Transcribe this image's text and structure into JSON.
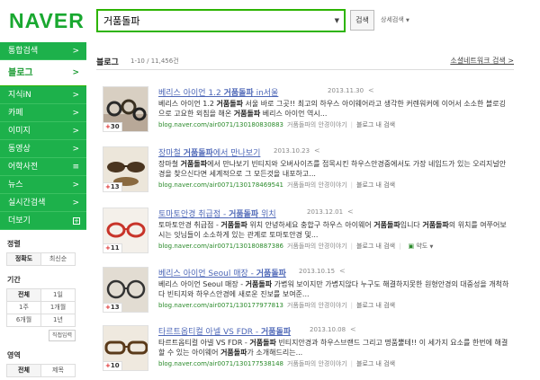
{
  "header": {
    "logo": "NAVER",
    "search_value": "거품돌파",
    "search_button": "검색",
    "advanced_search": "상세검색"
  },
  "sidebar": {
    "items": [
      {
        "label": "통합검색",
        "arrow": ">"
      },
      {
        "label": "블로그",
        "arrow": ">"
      },
      {
        "label": "지식iN",
        "arrow": ">"
      },
      {
        "label": "카페",
        "arrow": ">"
      },
      {
        "label": "이미지",
        "arrow": ">"
      },
      {
        "label": "동영상",
        "arrow": ">"
      },
      {
        "label": "어학사전",
        "arrow": "≡"
      },
      {
        "label": "뉴스",
        "arrow": ">"
      },
      {
        "label": "실시간검색",
        "arrow": ">"
      },
      {
        "label": "더보기",
        "arrow": "+"
      }
    ],
    "sort": {
      "title": "정렬",
      "options": [
        "정확도",
        "최신순"
      ]
    },
    "period": {
      "title": "기간",
      "options": [
        "전체",
        "1일",
        "1주",
        "1개월",
        "6개월",
        "1년"
      ],
      "direct": "직접입력"
    },
    "area": {
      "title": "영역",
      "options": [
        "전체",
        "제목"
      ]
    }
  },
  "results_header": {
    "title": "블로그",
    "count": "1-10 / 11,456건",
    "social_link": "소셜네트워크 검색 >"
  },
  "results": [
    {
      "title_pre": "베리스 아이언 1.2 ",
      "title_hl": "거품돌파",
      "title_post": " in서울",
      "date": "2013.11.30",
      "desc_parts": [
        "베리스 아이언 1.2 ",
        "거품돌파",
        " 서울 바로 그곳!! 최고의 하우스 아이웨어라고 생각한 커렌워커에 이어서 소소한 블로깅으로 고요한 외침을 해온 ",
        "거품돌파",
        " 베리스 아이언 역시..."
      ],
      "url": "blog.naver.com/air0071/130180830883",
      "blogname": "거품돌파의 안경이야기",
      "inblog": "블로그 내 검색",
      "badge": "30"
    },
    {
      "title_pre": "장마철 ",
      "title_hl": "거품돌파",
      "title_post": "에서 만나보기",
      "date": "2013.10.23",
      "desc_parts": [
        "장마철 ",
        "거품돌파",
        "에서 만나보기 빈티지와 오버사이즈를 접목시킨 하우스안경중에서도 가장 네임드가 있는 오리지널안경을 찾으신다면 세계적으로 그 모든것을 내포하고..."
      ],
      "url": "blog.naver.com/air0071/130178469541",
      "blogname": "거품돌파의 안경이야기",
      "inblog": "블로그 내 검색",
      "badge": "13"
    },
    {
      "title_pre": "토마토안경 취급점 - ",
      "title_hl": "거품돌파",
      "title_post": " 위치",
      "date": "2013.12.01",
      "desc_parts": [
        "토마토안경 취급점 - ",
        "거품돌파",
        " 위치 안녕하세요 충합구 하우스 아이웨어 ",
        "거품돌파",
        "입니다 ",
        "거품돌파",
        "의 위치를 여쭈어보시는 잇님들이 소소하게 있는 관계로 토마토안경 및..."
      ],
      "url": "blog.naver.com/air0071/130180887386",
      "blogname": "거품돌파의 안경이야기",
      "inblog": "블로그 내 검색",
      "map": "약도",
      "badge": "11"
    },
    {
      "title_pre": "베리스 아이언 Seoul 매장 - ",
      "title_hl": "거품돌파",
      "title_post": "",
      "date": "2013.10.15",
      "desc_parts": [
        "베리스 아이언 Seoul 매장 - ",
        "거품돌파",
        " 가볍워 보이지만 가볍지않다 누구도 해결하지못한 원형안경의 대중성을 개척하다 빈티지와 하우스안경에 새로운 진보를 보여준..."
      ],
      "url": "blog.naver.com/air0071/130177977813",
      "blogname": "거품돌파의 안경이야기",
      "inblog": "블로그 내 검색",
      "badge": "13"
    },
    {
      "title_pre": "타르트옵티컬 아넬 VS FDR - ",
      "title_hl": "거품돌파",
      "title_post": "",
      "date": "2013.10.08",
      "desc_parts": [
        "타르트옵티컬 아넬 VS FDR - ",
        "거품돌파",
        " 빈티지안경과 하우스브랜드 그리고 명품뿔테!! 이 세가지 요소를 한번에 해결할 수 있는 아이웨어 ",
        "거품돌파",
        "가 소개해드리는..."
      ],
      "url": "blog.naver.com/air0071/130177538148",
      "blogname": "거품돌파의 안경이야기",
      "inblog": "블로그 내 검색",
      "badge": "10"
    }
  ]
}
